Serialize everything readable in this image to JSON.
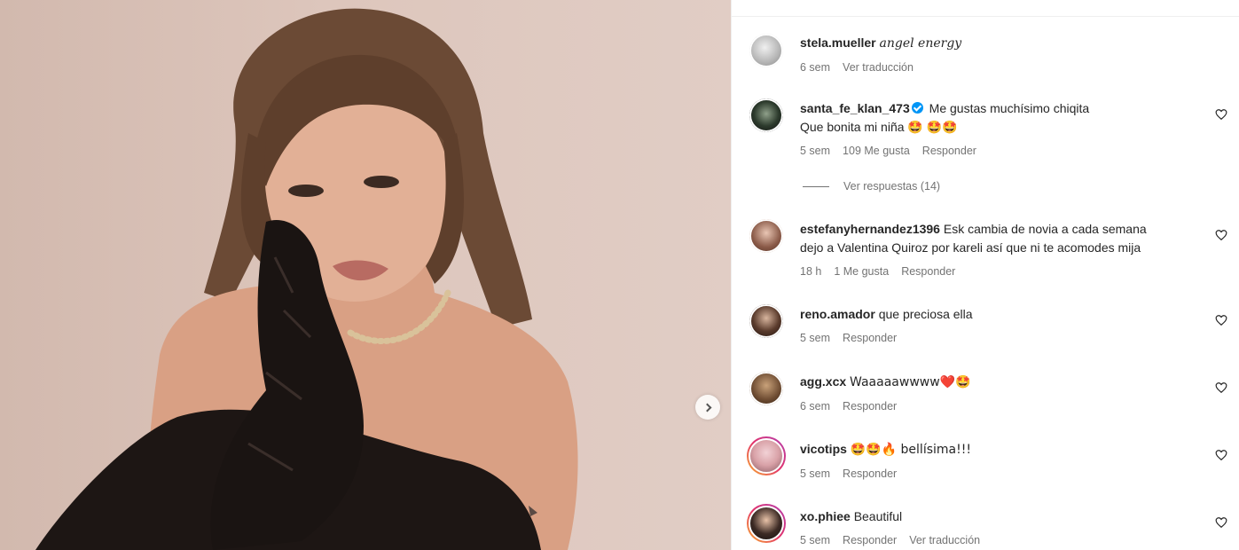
{
  "post": {
    "image_alt": "woman with bangs wearing black lace gloves and pearl necklace"
  },
  "comments": [
    {
      "username": "stela.mueller",
      "text": "angel energy",
      "time": "6 sem",
      "likes": "",
      "actions": [
        "Ver traducción"
      ]
    },
    {
      "username": "santa_fe_klan_473",
      "verified": true,
      "text": "Me gustas muchísimo chiqita",
      "text_line2": "Que bonita mi niña 🤩 🤩🤩",
      "time": "5 sem",
      "likes": "109 Me gusta",
      "actions": [
        "Responder"
      ],
      "replies_label": "Ver respuestas (14)"
    },
    {
      "username": "estefanyhernandez1396",
      "text": "Esk cambia de novia a cada semana",
      "text_line2": "dejo a Valentina Quiroz por kareli así que ni te acomodes mija",
      "time": "18 h",
      "likes": "1 Me gusta",
      "actions": [
        "Responder"
      ]
    },
    {
      "username": "reno.amador",
      "text": "que preciosa ella",
      "time": "5 sem",
      "actions": [
        "Responder"
      ]
    },
    {
      "username": "agg.xcx",
      "text": "Waaaaawwww❤️🤩",
      "time": "6 sem",
      "actions": [
        "Responder"
      ]
    },
    {
      "username": "vicotips",
      "text": "🤩🤩🔥 bellísima!!!",
      "time": "5 sem",
      "actions": [
        "Responder"
      ]
    },
    {
      "username": "xo.phiee",
      "text": "Beautiful",
      "time": "5 sem",
      "actions": [
        "Responder",
        "Ver traducción"
      ]
    }
  ],
  "colors": {
    "text": "#262626",
    "meta": "#737373",
    "verified": "#0095f6",
    "story_ring": "#e2336b"
  }
}
